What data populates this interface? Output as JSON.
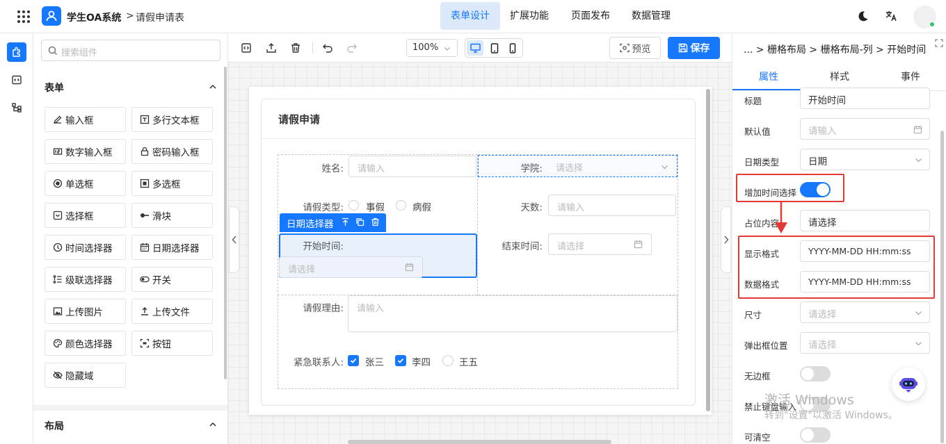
{
  "header": {
    "brand": "学生OA系统",
    "breadcrumb_sep": ">",
    "breadcrumb": "请假申请表",
    "tabs": [
      {
        "label": "表单设计",
        "active": true
      },
      {
        "label": "扩展功能",
        "active": false
      },
      {
        "label": "页面发布",
        "active": false
      },
      {
        "label": "数据管理",
        "active": false
      }
    ],
    "icons": [
      "apps-grid-icon",
      "user-icon",
      "moon-icon",
      "translate-icon",
      "avatar"
    ]
  },
  "palette": {
    "search_placeholder": "搜索组件",
    "form_section": "表单",
    "layout_section": "布局",
    "components": [
      {
        "label": "输入框",
        "icon": "pencil-icon"
      },
      {
        "label": "多行文本框",
        "icon": "textarea-icon"
      },
      {
        "label": "数字输入框",
        "icon": "number-icon"
      },
      {
        "label": "密码输入框",
        "icon": "lock-icon"
      },
      {
        "label": "单选框",
        "icon": "radio-icon"
      },
      {
        "label": "多选框",
        "icon": "checkbox-icon"
      },
      {
        "label": "选择框",
        "icon": "select-icon"
      },
      {
        "label": "滑块",
        "icon": "slider-icon"
      },
      {
        "label": "时间选择器",
        "icon": "clock-icon"
      },
      {
        "label": "日期选择器",
        "icon": "calendar-icon"
      },
      {
        "label": "级联选择器",
        "icon": "cascader-icon"
      },
      {
        "label": "开关",
        "icon": "switch-icon"
      },
      {
        "label": "上传图片",
        "icon": "image-icon"
      },
      {
        "label": "上传文件",
        "icon": "upload-icon"
      },
      {
        "label": "颜色选择器",
        "icon": "palette-icon"
      },
      {
        "label": "按钮",
        "icon": "button-icon"
      },
      {
        "label": "隐藏域",
        "icon": "eye-off-icon"
      }
    ]
  },
  "toolbar": {
    "zoom": "100%",
    "preview": "预览",
    "save": "保存"
  },
  "form": {
    "title": "请假申请",
    "name_label": "姓名:",
    "name_placeholder": "请输入",
    "college_label": "学院:",
    "college_placeholder": "请选择",
    "leave_type_label": "请假类型:",
    "leave_type_options": [
      "事假",
      "病假"
    ],
    "days_label": "天数:",
    "days_placeholder": "请输入",
    "selected_tag": "日期选择器",
    "start_label": "开始时间:",
    "start_placeholder": "请选择",
    "end_label": "结束时间:",
    "end_placeholder": "请选择",
    "reason_label": "请假理由:",
    "reason_placeholder": "请输入",
    "contact_label": "紧急联系人:",
    "contacts": [
      {
        "label": "张三",
        "checked": true
      },
      {
        "label": "李四",
        "checked": true
      },
      {
        "label": "王五",
        "checked": false
      }
    ]
  },
  "panel": {
    "breadcrumb": "... > 栅格布局 > 栅格布局-列 > 开始时间",
    "tabs": [
      "属性",
      "样式",
      "事件"
    ],
    "active_tab": "属性",
    "props": {
      "title_label": "标题",
      "title_value": "开始时间",
      "default_label": "默认值",
      "default_placeholder": "请输入",
      "datetype_label": "日期类型",
      "datetype_value": "日期",
      "addtime_label": "增加时间选择",
      "addtime_on": true,
      "placeholder_label": "占位内容",
      "placeholder_value": "请选择",
      "display_format_label": "显示格式",
      "display_format_value": "YYYY-MM-DD HH:mm:ss",
      "data_format_label": "数据格式",
      "data_format_value": "YYYY-MM-DD HH:mm:ss",
      "size_label": "尺寸",
      "size_placeholder": "请选择",
      "popup_label": "弹出框位置",
      "popup_placeholder": "请选择",
      "borderless_label": "无边框",
      "nokeyboard_label": "禁止键盘输入",
      "clearable_label": "可清空"
    }
  },
  "watermark": {
    "line1": "激活 Windows",
    "line2": "转到\"设置\"以激活 Windows。"
  },
  "colors": {
    "accent": "#1677ff",
    "highlight_red": "#e53935"
  }
}
